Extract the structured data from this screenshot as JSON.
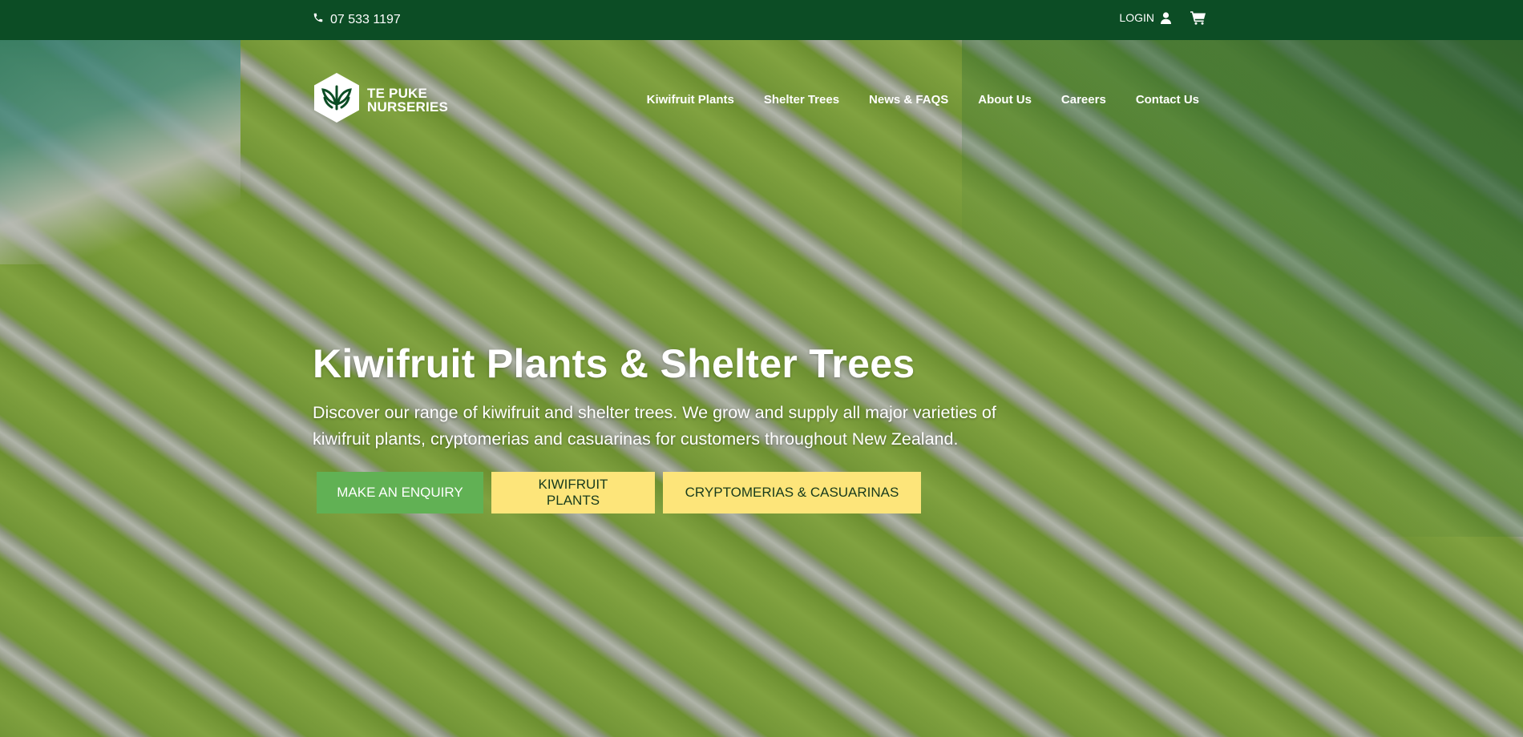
{
  "topbar": {
    "phone": "07 533 1197",
    "login_label": "LOGIN"
  },
  "logo": {
    "line1": "TE PUKE",
    "line2": "NURSERIES"
  },
  "nav": {
    "items": [
      {
        "label": "Kiwifruit Plants"
      },
      {
        "label": "Shelter Trees"
      },
      {
        "label": "News & FAQS"
      },
      {
        "label": "About Us"
      },
      {
        "label": "Careers"
      },
      {
        "label": "Contact Us"
      }
    ]
  },
  "hero": {
    "title": "Kiwifruit Plants & Shelter Trees",
    "description": "Discover our range of kiwifruit and shelter trees. We grow and supply all major varieties of kiwifruit plants, cryptomerias and casuarinas for customers throughout New Zealand.",
    "buttons": {
      "enquiry": "MAKE AN ENQUIRY",
      "kiwifruit": "KIWIFRUIT PLANTS",
      "cryptomerias": "CRYPTOMERIAS & CASUARINAS"
    }
  },
  "colors": {
    "topbar": "#0c4d25",
    "primary_button": "#61b154",
    "secondary_button": "#fde57a",
    "secondary_button_text": "#173a1c"
  },
  "icons": {
    "phone": "phone-icon",
    "user": "user-icon",
    "cart": "cart-icon",
    "logo": "leaf-hexagon-logo"
  }
}
